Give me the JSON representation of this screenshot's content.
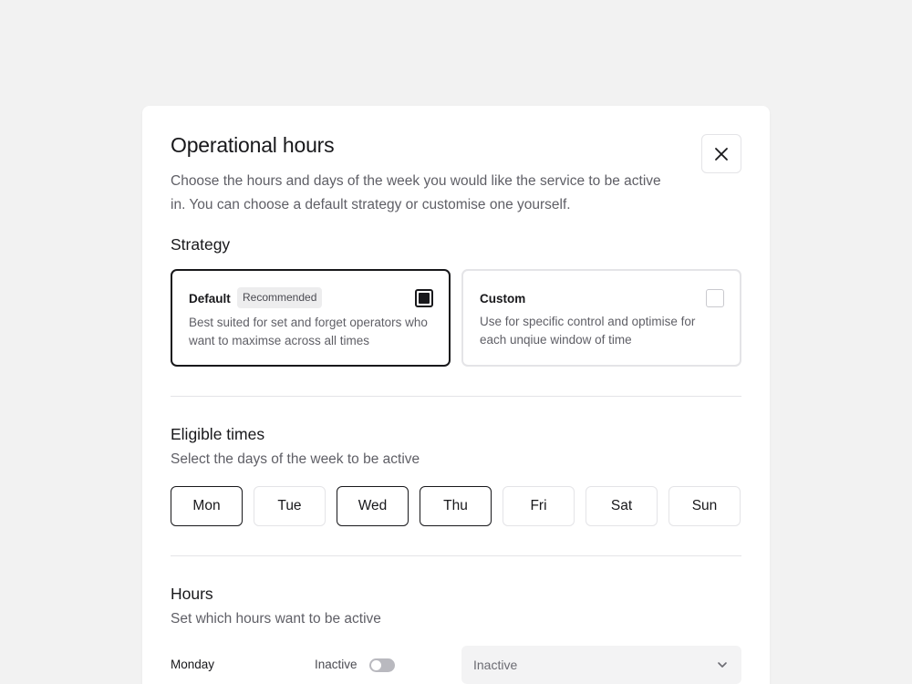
{
  "modal": {
    "title": "Operational hours",
    "description": "Choose the hours and days of the week you would like the service to be active in. You can choose a default strategy or customise one yourself.",
    "close_icon": "close-icon"
  },
  "strategy": {
    "heading": "Strategy",
    "options": [
      {
        "title": "Default",
        "badge": "Recommended",
        "description": "Best suited for set and forget operators who want to maximse across all times",
        "selected": true
      },
      {
        "title": "Custom",
        "description": "Use for specific control and optimise for each unqiue window of time",
        "selected": false
      }
    ]
  },
  "eligible": {
    "heading": "Eligible times",
    "subtitle": "Select the days of the week to be active",
    "days": [
      {
        "label": "Mon",
        "active": true
      },
      {
        "label": "Tue",
        "active": false
      },
      {
        "label": "Wed",
        "active": true
      },
      {
        "label": "Thu",
        "active": true
      },
      {
        "label": "Fri",
        "active": false
      },
      {
        "label": "Sat",
        "active": false
      },
      {
        "label": "Sun",
        "active": false
      }
    ]
  },
  "hours": {
    "heading": "Hours",
    "subtitle": "Set which hours want to be active",
    "rows": [
      {
        "day": "Monday",
        "status": "Inactive",
        "toggle_on": false,
        "select_value": "Inactive",
        "select_icon": "chevron-down-icon"
      }
    ]
  },
  "colors": {
    "background": "#f2f2f2",
    "surface": "#ffffff",
    "border": "#e4e4e7",
    "selected_border": "#18181b",
    "muted_text": "#5f5f66"
  }
}
